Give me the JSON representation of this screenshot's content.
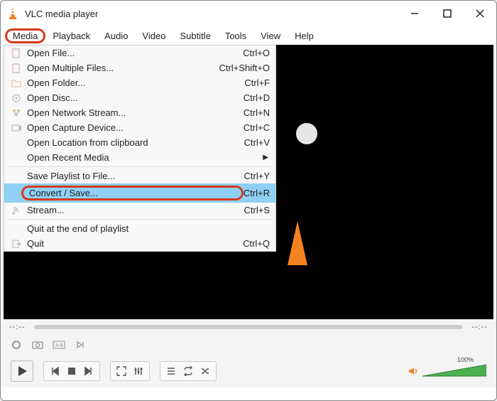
{
  "title": "VLC media player",
  "menubar": [
    "Media",
    "Playback",
    "Audio",
    "Video",
    "Subtitle",
    "Tools",
    "View",
    "Help"
  ],
  "menu_open_index": 0,
  "dropdown": {
    "items": [
      {
        "label": "Open File...",
        "shortcut": "Ctrl+O",
        "icon": "file"
      },
      {
        "label": "Open Multiple Files...",
        "shortcut": "Ctrl+Shift+O",
        "icon": "file"
      },
      {
        "label": "Open Folder...",
        "shortcut": "Ctrl+F",
        "icon": "folder"
      },
      {
        "label": "Open Disc...",
        "shortcut": "Ctrl+D",
        "icon": "disc"
      },
      {
        "label": "Open Network Stream...",
        "shortcut": "Ctrl+N",
        "icon": "network"
      },
      {
        "label": "Open Capture Device...",
        "shortcut": "Ctrl+C",
        "icon": "capture"
      },
      {
        "label": "Open Location from clipboard",
        "shortcut": "Ctrl+V",
        "icon": ""
      },
      {
        "label": "Open Recent Media",
        "shortcut": "",
        "icon": "",
        "arrow": true
      },
      {
        "sep": true
      },
      {
        "label": "Save Playlist to File...",
        "shortcut": "Ctrl+Y",
        "icon": ""
      },
      {
        "label": "Convert / Save...",
        "shortcut": "Ctrl+R",
        "icon": "",
        "selected": true
      },
      {
        "label": "Stream...",
        "shortcut": "Ctrl+S",
        "icon": "stream"
      },
      {
        "sep": true
      },
      {
        "label": "Quit at the end of playlist",
        "shortcut": "",
        "icon": ""
      },
      {
        "label": "Quit",
        "shortcut": "Ctrl+Q",
        "icon": "quit"
      }
    ]
  },
  "time_left": "--:--",
  "time_right": "--:--",
  "volume_pct": "100%",
  "colors": {
    "highlight": "#8fd0f4",
    "ring": "#d63b1e",
    "vol": "#4caf50"
  }
}
